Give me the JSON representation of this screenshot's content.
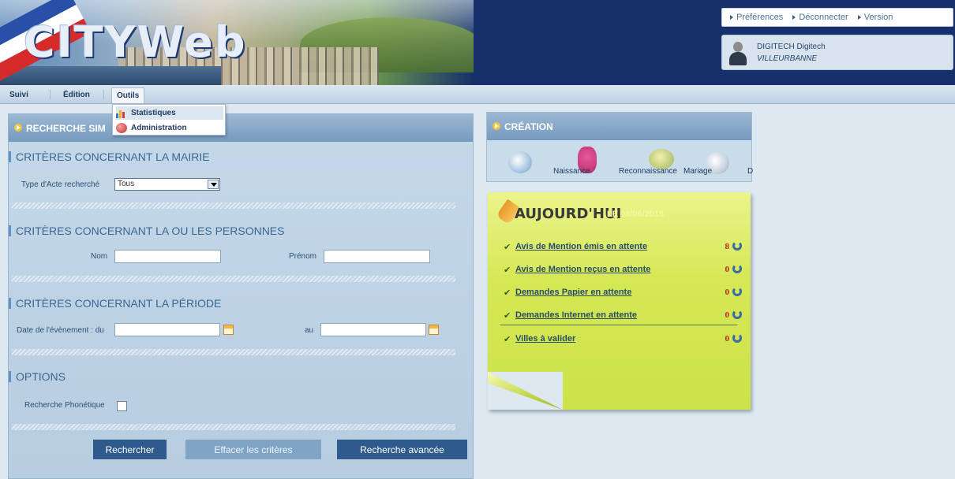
{
  "header": {
    "logo_text": "CITYWeb",
    "top_links": [
      "Préférences",
      "Déconnecter",
      "Version"
    ],
    "user_name": "DIGITECH Digitech",
    "user_city": "VILLEURBANNE"
  },
  "nav": {
    "items": [
      "Suivi",
      "Édition",
      "Outils"
    ],
    "active": "Outils",
    "dropdown": [
      "Statistiques",
      "Administration"
    ]
  },
  "search": {
    "header_title": "RECHERCHE SIM",
    "section_mairie": "CRITÈRES CONCERNANT LA MAIRIE",
    "type_label": "Type d'Acte recherché",
    "type_value": "Tous",
    "section_personnes": "CRITÈRES CONCERNANT LA OU LES PERSONNES",
    "nom_label": "Nom",
    "nom_value": "",
    "prenom_label": "Prénom",
    "prenom_value": "",
    "section_periode": "CRITÈRES CONCERNANT LA PÉRIODE",
    "date_du_label": "Date de l'évènement : du",
    "date_du_value": "",
    "date_au_label": "au",
    "date_au_value": "",
    "section_options": "OPTIONS",
    "phonetique_label": "Recherche Phonétique",
    "phonetique_checked": false,
    "btn_search": "Rechercher",
    "btn_clear": "Effacer les critères",
    "btn_advanced": "Recherche avancée"
  },
  "creation": {
    "title": "CRÉATION",
    "items": [
      "Naissance",
      "Reconnaissance",
      "Mariage",
      "D"
    ]
  },
  "today": {
    "title": "AUJOURD'HUI",
    "date": "LE 08/06/2015",
    "rows": [
      {
        "label": "Avis de Mention émis en attente",
        "count": "8"
      },
      {
        "label": "Avis de Mention reçus en attente",
        "count": "0"
      },
      {
        "label": "Demandes Papier en attente",
        "count": "0"
      },
      {
        "label": "Demandes Internet en attente",
        "count": "0"
      },
      {
        "label": "Villes à valider",
        "count": "0"
      }
    ]
  }
}
